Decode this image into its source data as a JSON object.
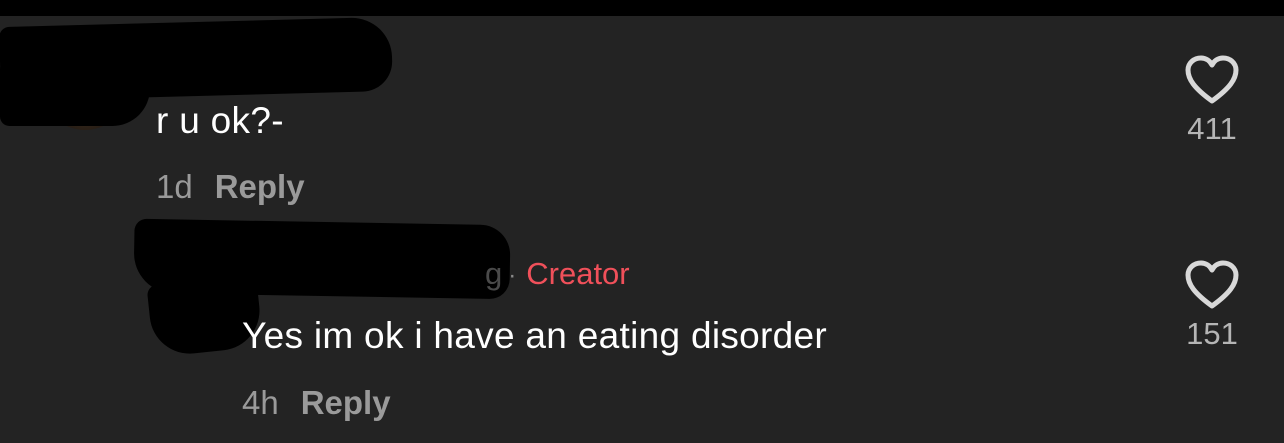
{
  "comments": [
    {
      "text": "r u ok?-",
      "time": "1d",
      "reply_label": "Reply",
      "like_count": "411"
    },
    {
      "username_fragment": "g",
      "badge_separator": "·",
      "badge": "Creator",
      "text": "Yes im ok i have an eating disorder",
      "time": "4h",
      "reply_label": "Reply",
      "like_count": "151"
    }
  ],
  "colors": {
    "background": "#232323",
    "text": "#ffffff",
    "meta": "#9a9a9a",
    "creator_badge": "#f0505a",
    "redaction": "#000000"
  },
  "icons": {
    "like": "heart-outline-icon"
  }
}
